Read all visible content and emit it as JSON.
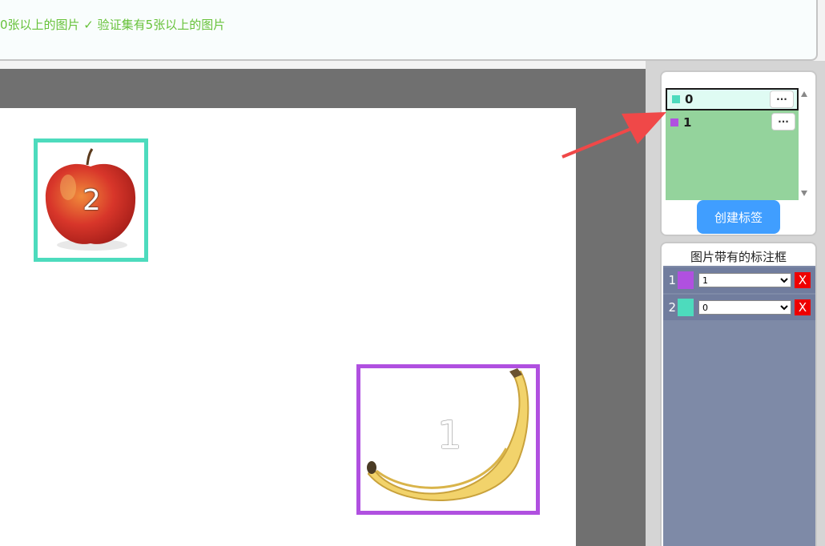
{
  "top_bar": {
    "status_text": "0张以上的图片 ✓ 验证集有5张以上的图片"
  },
  "canvas": {
    "boxes": [
      {
        "number": "2",
        "label": "0",
        "object": "apple",
        "color": "#4ddbbd"
      },
      {
        "number": "1",
        "label": "1",
        "object": "banana",
        "color": "#b050e0"
      }
    ]
  },
  "label_panel": {
    "labels": [
      {
        "name": "0",
        "color": "#4ddbbd",
        "more": "···",
        "selected": true
      },
      {
        "name": "1",
        "color": "#b050e0",
        "more": "···",
        "selected": false
      }
    ],
    "create_button": "创建标签"
  },
  "bbox_panel": {
    "title": "图片带有的标注框",
    "rows": [
      {
        "index": "1",
        "color": "#b050e0",
        "selected": "1",
        "delete": "X"
      },
      {
        "index": "2",
        "color": "#4ddbbd",
        "selected": "0",
        "delete": "X"
      }
    ],
    "options": [
      "0",
      "1"
    ]
  },
  "colors": {
    "accent": "#409eff",
    "status_green": "#67c23a",
    "delete_red": "#ee0000",
    "annotation_arrow": "#f04848"
  }
}
